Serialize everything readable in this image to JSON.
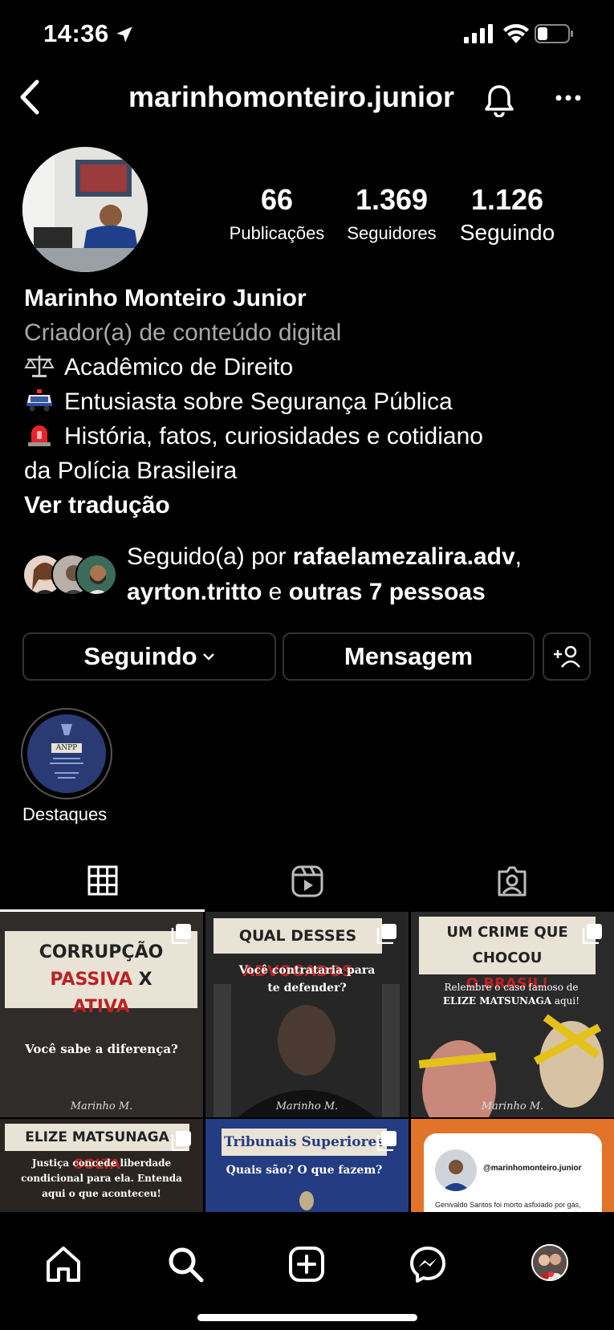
{
  "status_bar": {
    "time": "14:36"
  },
  "header": {
    "username": "marinhomonteiro.junior"
  },
  "profile": {
    "stats": [
      {
        "value": "66",
        "label": "Publicações"
      },
      {
        "value": "1.369",
        "label": "Seguidores"
      },
      {
        "value": "1.126",
        "label": "Seguindo"
      }
    ],
    "name": "Marinho Monteiro Junior",
    "category": "Criador(a) de conteúdo digital",
    "bio_lines": [
      "Acadêmico de Direito",
      "Entusiasta sobre Segurança Pública",
      "História, fatos, curiosidades e cotidiano",
      "da Polícia Brasileira"
    ],
    "see_translation": "Ver tradução"
  },
  "followed_by": {
    "prefix": "Seguido(a) por ",
    "user1": "rafaelamezalira.adv",
    "sep": ",",
    "user2": "ayrton.tritto",
    "and": " e ",
    "others": "outras 7 pessoas"
  },
  "actions": {
    "following": "Seguindo",
    "message": "Mensagem"
  },
  "highlights": [
    {
      "label": "Destaques",
      "cover_title": "ANPP"
    }
  ],
  "posts": [
    {
      "banner_a": "CORRUPÇÃO ",
      "banner_b": "PASSIVA",
      "banner_c": " X",
      "banner_d": "ATIVA",
      "body": "Você sabe a diferença?",
      "sign": "Marinho M."
    },
    {
      "banner_a": "QUAL DESSES ",
      "banner_b": "ADVOGADOS",
      "body": "Você contrataria para te defender?",
      "sign": "Marinho M."
    },
    {
      "banner_a": "UM CRIME QUE CHOCOU",
      "banner_b": "O BRASIL!",
      "body_a": "Relembre o caso famoso de ",
      "body_b": "ELIZE MATSUNAGA",
      "body_c": " aqui!",
      "sign": "Marinho M."
    },
    {
      "banner_a": "ELIZE MATSUNAGA ",
      "banner_b": "SOLTA",
      "body": "Justiça concede liberdade condicional para ela. Entenda aqui o que aconteceu!"
    },
    {
      "banner_a": "Tribunais Superiores",
      "body": "Quais são? O que fazem?"
    },
    {
      "handle": "@marinhomonteiro.junior",
      "body": "Genivaldo Santos foi morto asfixiado por gás, (repise-se: por gás), pela PRF no estado do"
    }
  ]
}
